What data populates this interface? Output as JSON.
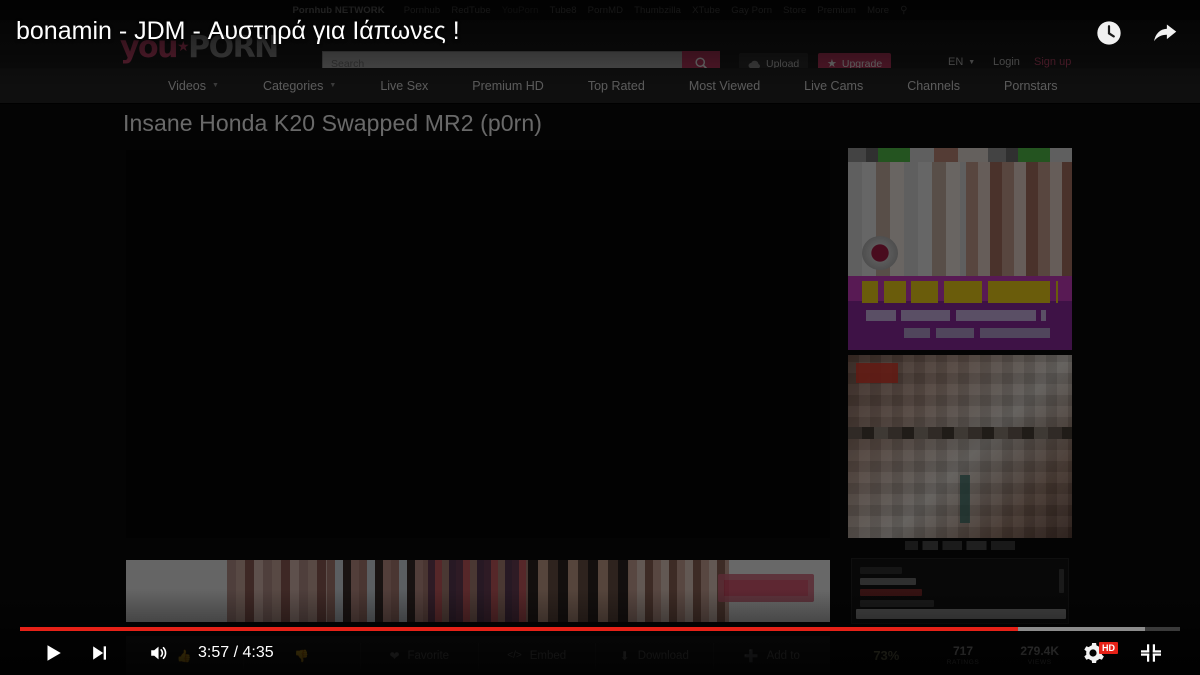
{
  "player": {
    "video_title": "bonamin - JDM - Αυστηρά για Ιάπωνες !",
    "current_time": "3:57",
    "duration": "4:35",
    "time_display": "3:57 / 4:35",
    "progress_percent": 86,
    "loaded_percent": 97,
    "quality_badge": "HD",
    "controls": {
      "play_label": "Play",
      "next_label": "Next video",
      "volume_label": "Mute",
      "settings_label": "Settings",
      "fullscreen_label": "Exit full screen"
    },
    "top_actions": {
      "watch_later_label": "Watch later",
      "share_label": "Share"
    },
    "accent_color": "#e62117"
  },
  "site": {
    "network_bar": {
      "brand": "Pornhub NETWORK",
      "links": [
        {
          "label": "Pornhub",
          "muted": false
        },
        {
          "label": "RedTube",
          "muted": false
        },
        {
          "label": "YouPorn",
          "muted": true
        },
        {
          "label": "Tube8",
          "muted": false
        },
        {
          "label": "PornMD",
          "muted": false
        },
        {
          "label": "Thumbzilla",
          "muted": false
        },
        {
          "label": "XTube",
          "muted": false
        },
        {
          "label": "Gay Porn",
          "muted": false
        },
        {
          "label": "Store",
          "muted": false
        },
        {
          "label": "Premium",
          "muted": false
        },
        {
          "label": "More",
          "muted": false
        }
      ],
      "search_icon": "search-icon"
    },
    "header": {
      "logo_you": "you",
      "logo_porn": "PORN",
      "search_placeholder": "Search",
      "search_value": "",
      "upload_label": "Upload",
      "upgrade_label": "Upgrade",
      "language": "EN",
      "login_label": "Login",
      "signup_label": "Sign up",
      "accent_color": "#c23a62"
    },
    "nav": [
      {
        "label": "Videos",
        "has_caret": true
      },
      {
        "label": "Categories",
        "has_caret": true
      },
      {
        "label": "Live Sex",
        "has_caret": false
      },
      {
        "label": "Premium HD",
        "has_caret": false
      },
      {
        "label": "Top Rated",
        "has_caret": false
      },
      {
        "label": "Most Viewed",
        "has_caret": false
      },
      {
        "label": "Live Cams",
        "has_caret": false
      },
      {
        "label": "Channels",
        "has_caret": false
      },
      {
        "label": "Pornstars",
        "has_caret": false
      }
    ],
    "video": {
      "title": "Insane Honda K20 Swapped MR2  (p0rn)"
    },
    "actions": [
      {
        "label": "Favorite",
        "icon": "heart-icon"
      },
      {
        "label": "Embed",
        "icon": "code-icon"
      },
      {
        "label": "Download",
        "icon": "download-icon"
      },
      {
        "label": "Add to",
        "icon": "plus-icon"
      }
    ],
    "stats": [
      {
        "value": "73%",
        "label": "",
        "kind": "rating"
      },
      {
        "value": "717",
        "label": "RATINGS",
        "kind": "count"
      },
      {
        "value": "279.4K",
        "label": "VIEWS",
        "kind": "count"
      }
    ]
  }
}
